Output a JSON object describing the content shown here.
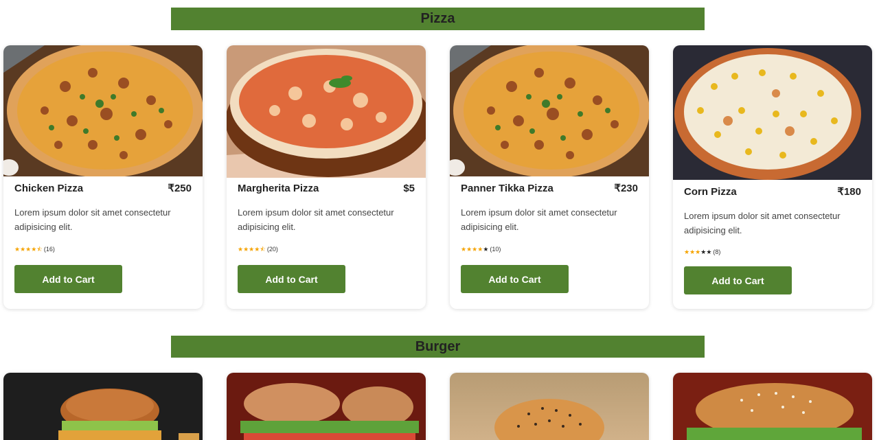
{
  "sections": {
    "pizza": "Pizza",
    "burger": "Burger"
  },
  "pizzas": [
    {
      "name": "Chicken Pizza",
      "price": "₹250",
      "desc": "Lorem ipsum dolor sit amet consectetur adipisicing elit.",
      "rating": 4.5,
      "count": "(16)",
      "cta": "Add to Cart"
    },
    {
      "name": "Margherita Pizza",
      "price": "$5",
      "desc": "Lorem ipsum dolor sit amet consectetur adipisicing elit.",
      "rating": 4.5,
      "count": "(20)",
      "cta": "Add to Cart"
    },
    {
      "name": "Panner Tikka Pizza",
      "price": "₹230",
      "desc": "Lorem ipsum dolor sit amet consectetur adipisicing elit.",
      "rating": 4,
      "count": "(10)",
      "cta": "Add to Cart"
    },
    {
      "name": "Corn Pizza",
      "price": "₹180",
      "desc": "Lorem ipsum dolor sit amet consectetur adipisicing elit.",
      "rating": 3,
      "count": "(8)",
      "cta": "Add to Cart"
    }
  ],
  "colors": {
    "accent": "#528230",
    "star": "#f5a300"
  }
}
